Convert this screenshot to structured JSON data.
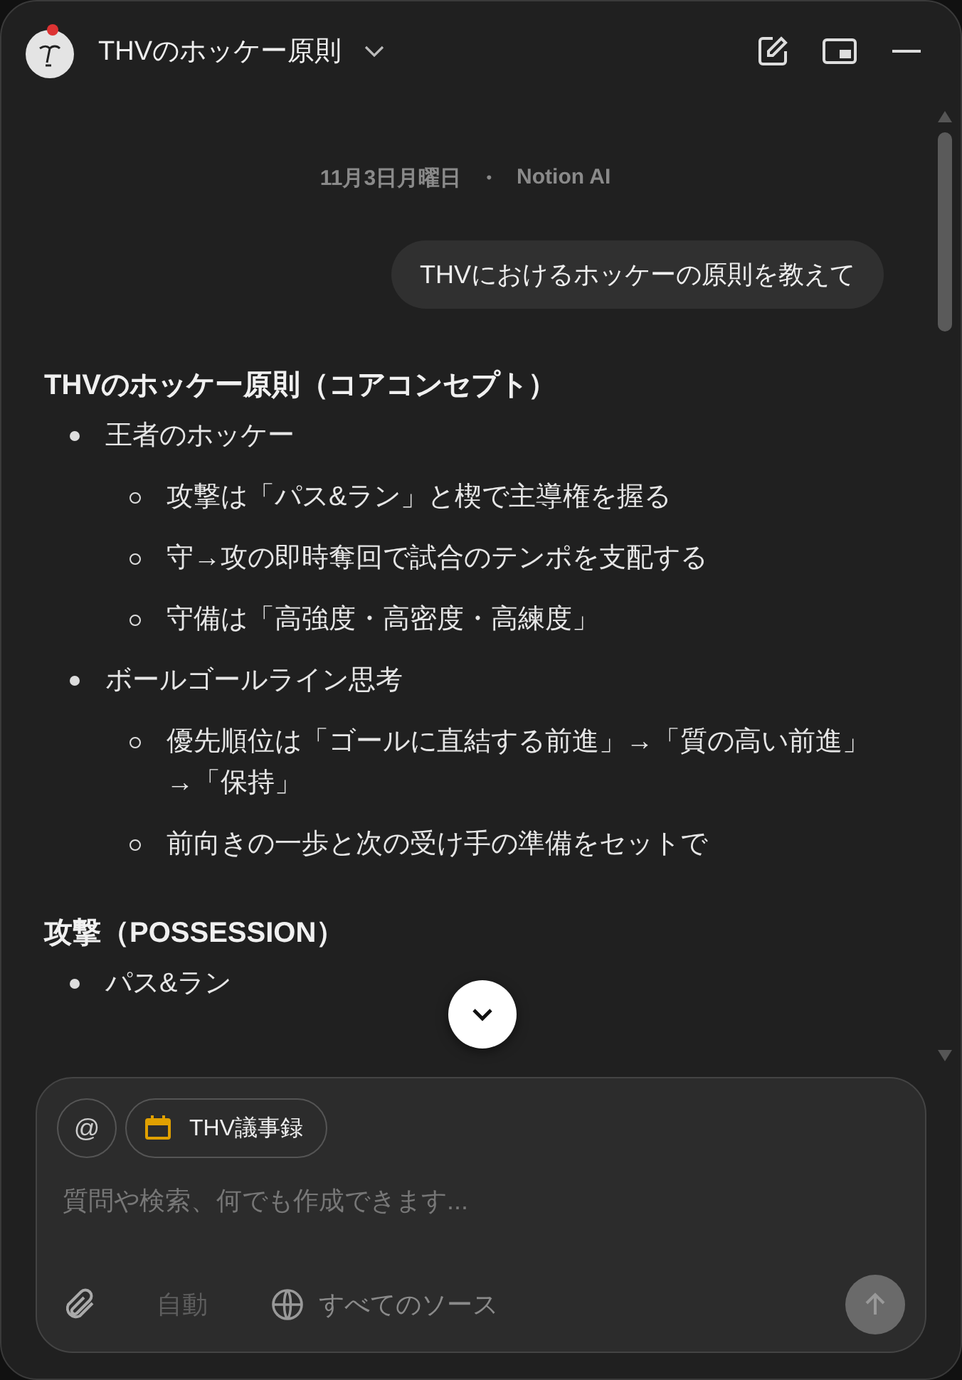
{
  "header": {
    "title": "THVのホッケー原則"
  },
  "chat": {
    "date": "11月3日月曜日",
    "separator": "・",
    "author": "Notion AI",
    "user_message": "THVにおけるホッケーの原則を教えて",
    "sections": [
      {
        "heading": "THVのホッケー原則（コアコンセプト）",
        "items": [
          {
            "text": "王者のホッケー",
            "children": [
              {
                "text": "攻撃は「パス&ラン」と楔で主導権を握る"
              },
              {
                "text": "守→攻の即時奪回で試合のテンポを支配する"
              },
              {
                "text": "守備は「高強度・高密度・高練度」"
              }
            ]
          },
          {
            "text": "ボールゴールライン思考",
            "children": [
              {
                "text": "優先順位は「ゴールに直結する前進」→「質の高い前進」→「保持」"
              },
              {
                "text": "前向きの一歩と次の受け手の準備をセットで"
              }
            ]
          }
        ]
      },
      {
        "heading": "攻撃（POSSESSION）",
        "items": [
          {
            "text": "パス&ラン"
          }
        ]
      }
    ]
  },
  "composer": {
    "mention": "@",
    "context_chip": "THV議事録",
    "placeholder": "質問や検索、何でも作成できます...",
    "model": "自動",
    "sources": "すべてのソース",
    "send_disabled": true
  }
}
